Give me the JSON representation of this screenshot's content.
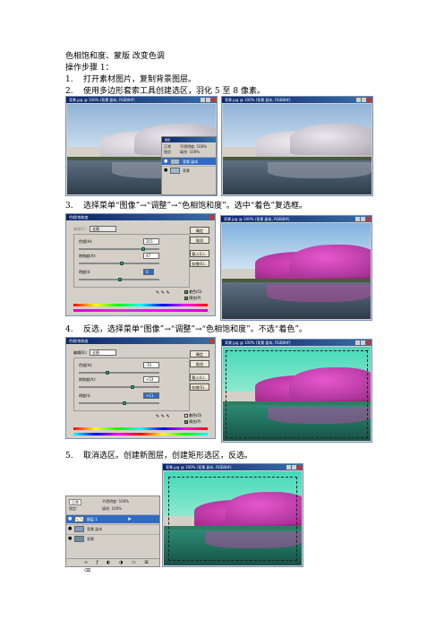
{
  "doc": {
    "title": "色相饱和度、蒙版 改变色调",
    "subtitle": "操作步骤 1：",
    "steps": [
      {
        "num": "1.",
        "text": "打开素材图片，复制背景图层。"
      },
      {
        "num": "2.",
        "text": "使用多边形套索工具创建选区，羽化 5 至 8 像素。"
      },
      {
        "num": "3.",
        "text": "选择菜单“图像”→“调整”→“色相饱和度”。选中“着色”复选框。"
      },
      {
        "num": "4.",
        "text": "反选，选择菜单“图像”→“调整”→“色相饱和度”。不选“着色”。"
      },
      {
        "num": "5.",
        "text": "取消选区。创建新图层，创建矩形选区，反选。"
      }
    ]
  },
  "windows": {
    "photo_title": "背景.jpg @ 100% (背景 副本, RGB/8#)"
  },
  "dialog1": {
    "title": "色相/饱和度",
    "edit_label": "编辑(E):",
    "edit_value": "全图",
    "hue_label": "色相(H):",
    "hue_value": "315",
    "sat_label": "饱和度(A):",
    "sat_value": "47",
    "light_label": "明度(I):",
    "light_value": "0",
    "buttons": [
      "确定",
      "取消",
      "载入(L)...",
      "存储(S)..."
    ],
    "colorize_label": "着色(O)",
    "preview_label": "预览(P)",
    "colorize_checked": true,
    "preview_checked": true
  },
  "dialog2": {
    "title": "色相/饱和度",
    "edit_label": "编辑(E):",
    "edit_value": "全图",
    "hue_label": "色相(H):",
    "hue_value": "-51",
    "sat_label": "饱和度(A):",
    "sat_value": "+53",
    "light_label": "明度(I):",
    "light_value": "+11",
    "buttons": [
      "确定",
      "取消",
      "载入(L)...",
      "存储(S)..."
    ],
    "colorize_label": "着色(O)",
    "preview_label": "预览(P)",
    "colorize_checked": false,
    "preview_checked": true
  },
  "layers_small": {
    "mode": "正常",
    "opacity": "不透明度: 100%",
    "fill": "填充: 100%",
    "lock": "锁定:",
    "rows": [
      "背景 副本",
      "背景"
    ]
  },
  "layers_big": {
    "mode": "正常",
    "opacity": "不透明度: 100%",
    "fill": "填充: 100%",
    "lock": "锁定:",
    "rows": [
      "图层 1",
      "背景 副本",
      "背景"
    ]
  },
  "colors": {
    "sky_blue": "#b9d3ea",
    "blossom_white": "#e6e3e8",
    "blossom_pink": "#cc3bb4",
    "tint_teal": "#3fd8b4",
    "water_dark": "#3c4c5c"
  }
}
